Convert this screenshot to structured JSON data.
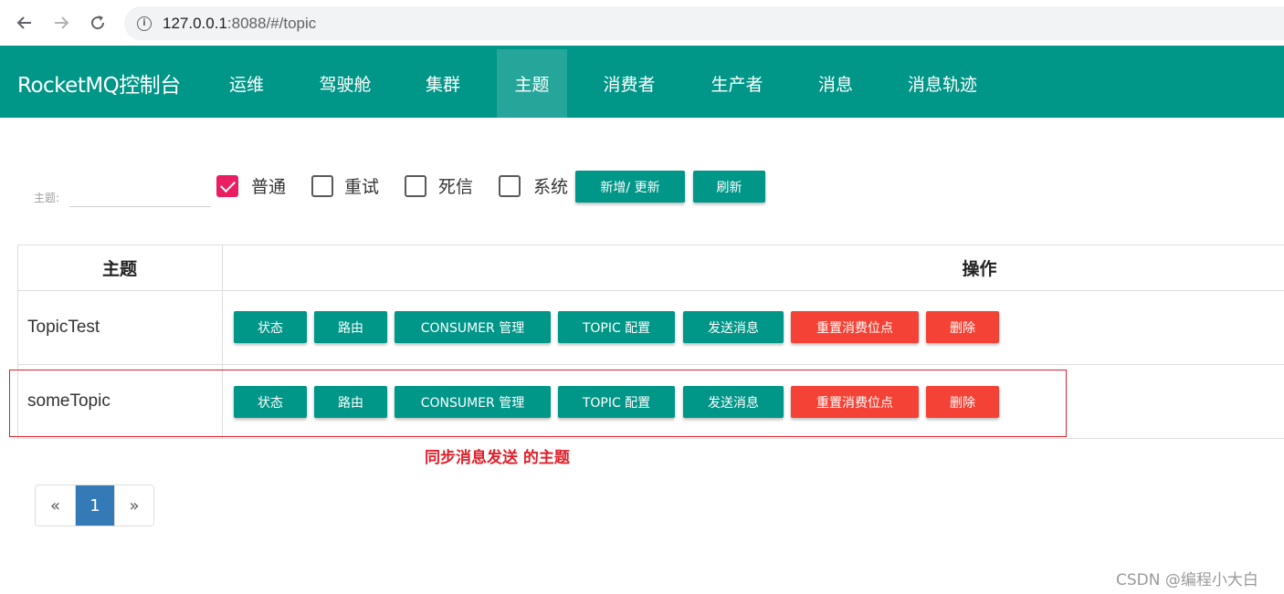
{
  "browser": {
    "url_host": "127.0.0.1",
    "url_rest": ":8088/#/topic"
  },
  "header": {
    "brand": "RocketMQ控制台",
    "nav": [
      "运维",
      "驾驶舱",
      "集群",
      "主题",
      "消费者",
      "生产者",
      "消息",
      "消息轨迹"
    ],
    "active_nav": "主题"
  },
  "filter": {
    "topic_label": "主题:",
    "checkboxes": [
      {
        "label": "普通",
        "checked": true
      },
      {
        "label": "重试",
        "checked": false
      },
      {
        "label": "死信",
        "checked": false
      },
      {
        "label": "系统",
        "checked": false
      }
    ],
    "add_update_label": "新增/ 更新",
    "refresh_label": "刷新"
  },
  "table": {
    "headers": [
      "主题",
      "操作"
    ],
    "rows": [
      {
        "topic": "TopicTest"
      },
      {
        "topic": "someTopic"
      }
    ],
    "actions": [
      "状态",
      "路由",
      "CONSUMER 管理",
      "TOPIC 配置",
      "发送消息",
      "重置消费位点",
      "删除"
    ]
  },
  "annotation": "同步消息发送 的主题",
  "pagination": {
    "prev": "«",
    "current": "1",
    "next": "»"
  },
  "watermark": "CSDN @编程小大白",
  "colors": {
    "primary": "#009688",
    "primary_active": "#26a69a",
    "danger": "#f44336",
    "checkbox_checked": "#e91e63",
    "pager_active": "#337ab7",
    "annotation": "#e0202a"
  }
}
